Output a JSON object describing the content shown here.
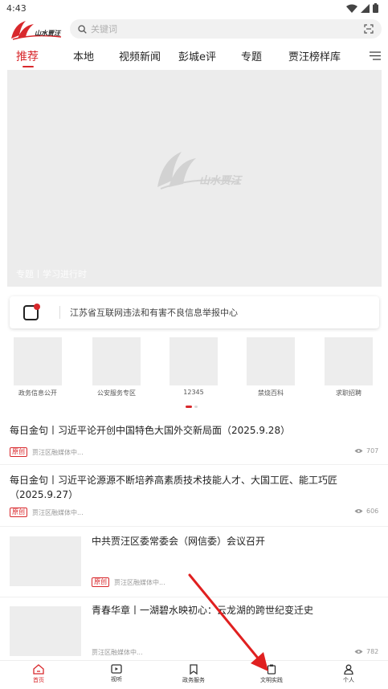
{
  "status": {
    "time": "4:43"
  },
  "search": {
    "placeholder": "关键词"
  },
  "tabs": [
    {
      "label": "推荐",
      "active": true
    },
    {
      "label": "本地"
    },
    {
      "label": "视频新闻"
    },
    {
      "label": "彭城e评"
    },
    {
      "label": "专题"
    },
    {
      "label": "贾汪榜样库"
    }
  ],
  "banner": {
    "caption": "专题丨学习进行时"
  },
  "report": {
    "text": "江苏省互联网违法和有害不良信息举报中心"
  },
  "services": [
    {
      "label": "政务信息公开"
    },
    {
      "label": "公安服务专区"
    },
    {
      "label": "12345"
    },
    {
      "label": "禁烧百科"
    },
    {
      "label": "求职招聘"
    }
  ],
  "news": [
    {
      "title": "每日金句丨习近平论开创中国特色大国外交新局面（2025.9.28）",
      "tag": "原创",
      "source": "贾汪区融媒体中...",
      "views": "707"
    },
    {
      "title": "每日金句丨习近平论源源不断培养高素质技术技能人才、大国工匠、能工巧匠（2025.9.27）",
      "tag": "原创",
      "source": "贾汪区融媒体中...",
      "views": "606"
    },
    {
      "title": "中共贾汪区委常委会（网信委）会议召开",
      "tag": "原创",
      "source": "贾汪区融媒体中...",
      "views": ""
    },
    {
      "title": "青春华章丨一湖碧水映初心：云龙湖的跨世纪变迁史",
      "tag": "",
      "source": "贾汪区融媒体中...",
      "views": "782"
    }
  ],
  "bottomnav": [
    {
      "label": "首页",
      "icon": "home-icon",
      "active": true
    },
    {
      "label": "视听",
      "icon": "video-icon"
    },
    {
      "label": "政务服务",
      "icon": "bookmark-icon"
    },
    {
      "label": "文明实践",
      "icon": "clipboard-icon"
    },
    {
      "label": "个人",
      "icon": "person-icon"
    }
  ],
  "colors": {
    "accent": "#d8282c",
    "placeholder_bg": "#ececec"
  }
}
